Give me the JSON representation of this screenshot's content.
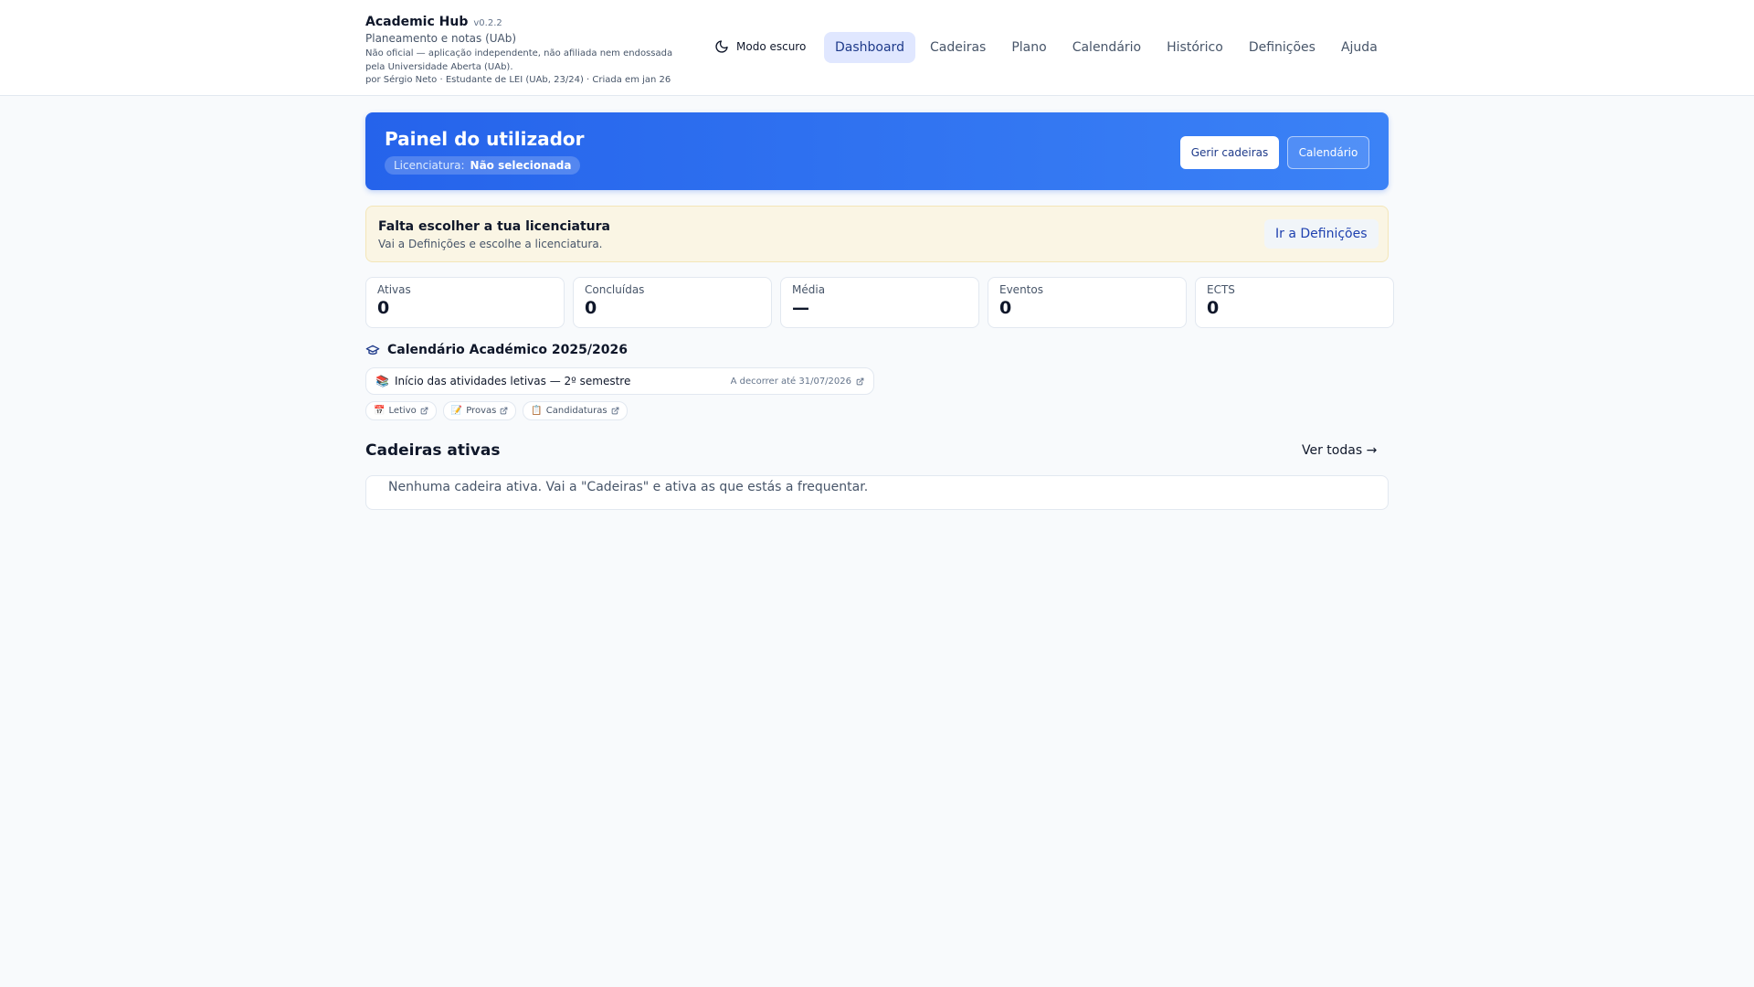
{
  "header": {
    "title": "Academic Hub",
    "version": "v0.2.2",
    "subtitle": "Planeamento e notas (UAb)",
    "disclaimer": "Não oficial — aplicação independente, não afiliada nem endossada pela Universidade Aberta (UAb).",
    "author": "por Sérgio Neto · Estudante de LEI (UAb, 23/24) · Criada em jan 26",
    "dark_mode_label": "Modo escuro"
  },
  "nav": {
    "items": [
      {
        "label": "Dashboard"
      },
      {
        "label": "Cadeiras"
      },
      {
        "label": "Plano"
      },
      {
        "label": "Calendário"
      },
      {
        "label": "Histórico"
      },
      {
        "label": "Definições"
      },
      {
        "label": "Ajuda"
      }
    ],
    "active": "Dashboard"
  },
  "hero": {
    "title": "Painel do utilizador",
    "degree_label": "Licenciatura:",
    "degree_value": "Não selecionada",
    "manage_button": "Gerir cadeiras",
    "calendar_button": "Calendário"
  },
  "alert": {
    "title": "Falta escolher a tua licenciatura",
    "message": "Vai a Definições e escolhe a licenciatura.",
    "button": "Ir a Definições"
  },
  "stats": [
    {
      "label": "Ativas",
      "value": "0"
    },
    {
      "label": "Concluídas",
      "value": "0"
    },
    {
      "label": "Média",
      "value": "—"
    },
    {
      "label": "Eventos",
      "value": "0"
    },
    {
      "label": "ECTS",
      "value": "0"
    }
  ],
  "academic_calendar": {
    "title": "Calendário Académico 2025/2026",
    "current_event": {
      "emoji": "📚",
      "text": "Início das atividades letivas — 2º semestre",
      "status": "A decorrer até 31/07/2026"
    },
    "links": [
      {
        "emoji": "📅",
        "label": "Letivo"
      },
      {
        "emoji": "📝",
        "label": "Provas"
      },
      {
        "emoji": "📋",
        "label": "Candidaturas"
      }
    ]
  },
  "active_courses": {
    "title": "Cadeiras ativas",
    "see_all": "Ver todas →",
    "empty_message": "Nenhuma cadeira ativa. Vai a \"Cadeiras\" e ativa as que estás a frequentar."
  },
  "colors": {
    "primary": "#2563eb",
    "primary_light": "#3b82f6",
    "alert_bg": "#faf5e4",
    "page_bg": "#f8fafc"
  }
}
